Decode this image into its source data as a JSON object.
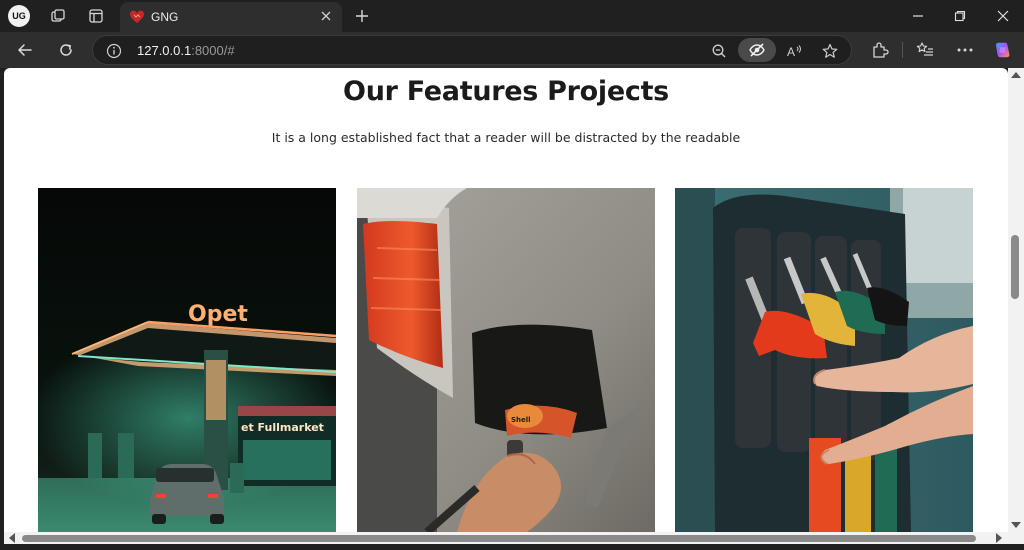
{
  "browser": {
    "profile_label": "UG",
    "tab": {
      "title": "GNG"
    },
    "address": {
      "host": "127.0.0.1",
      "rest": ":8000/#"
    }
  },
  "page": {
    "title": "Our Features Projects",
    "subtitle": "It is a long established fact that a reader will be distracted by the readable",
    "cards": [
      {
        "sign_text": "Opet",
        "market_text": "et Fullmarket"
      },
      {
        "cap_text": "Shell"
      },
      {}
    ]
  },
  "colors": {
    "tab_bg": "#2e2e2e",
    "chrome_bg": "#202020",
    "page_bg": "#ffffff",
    "title_color": "#1b1b1b"
  }
}
